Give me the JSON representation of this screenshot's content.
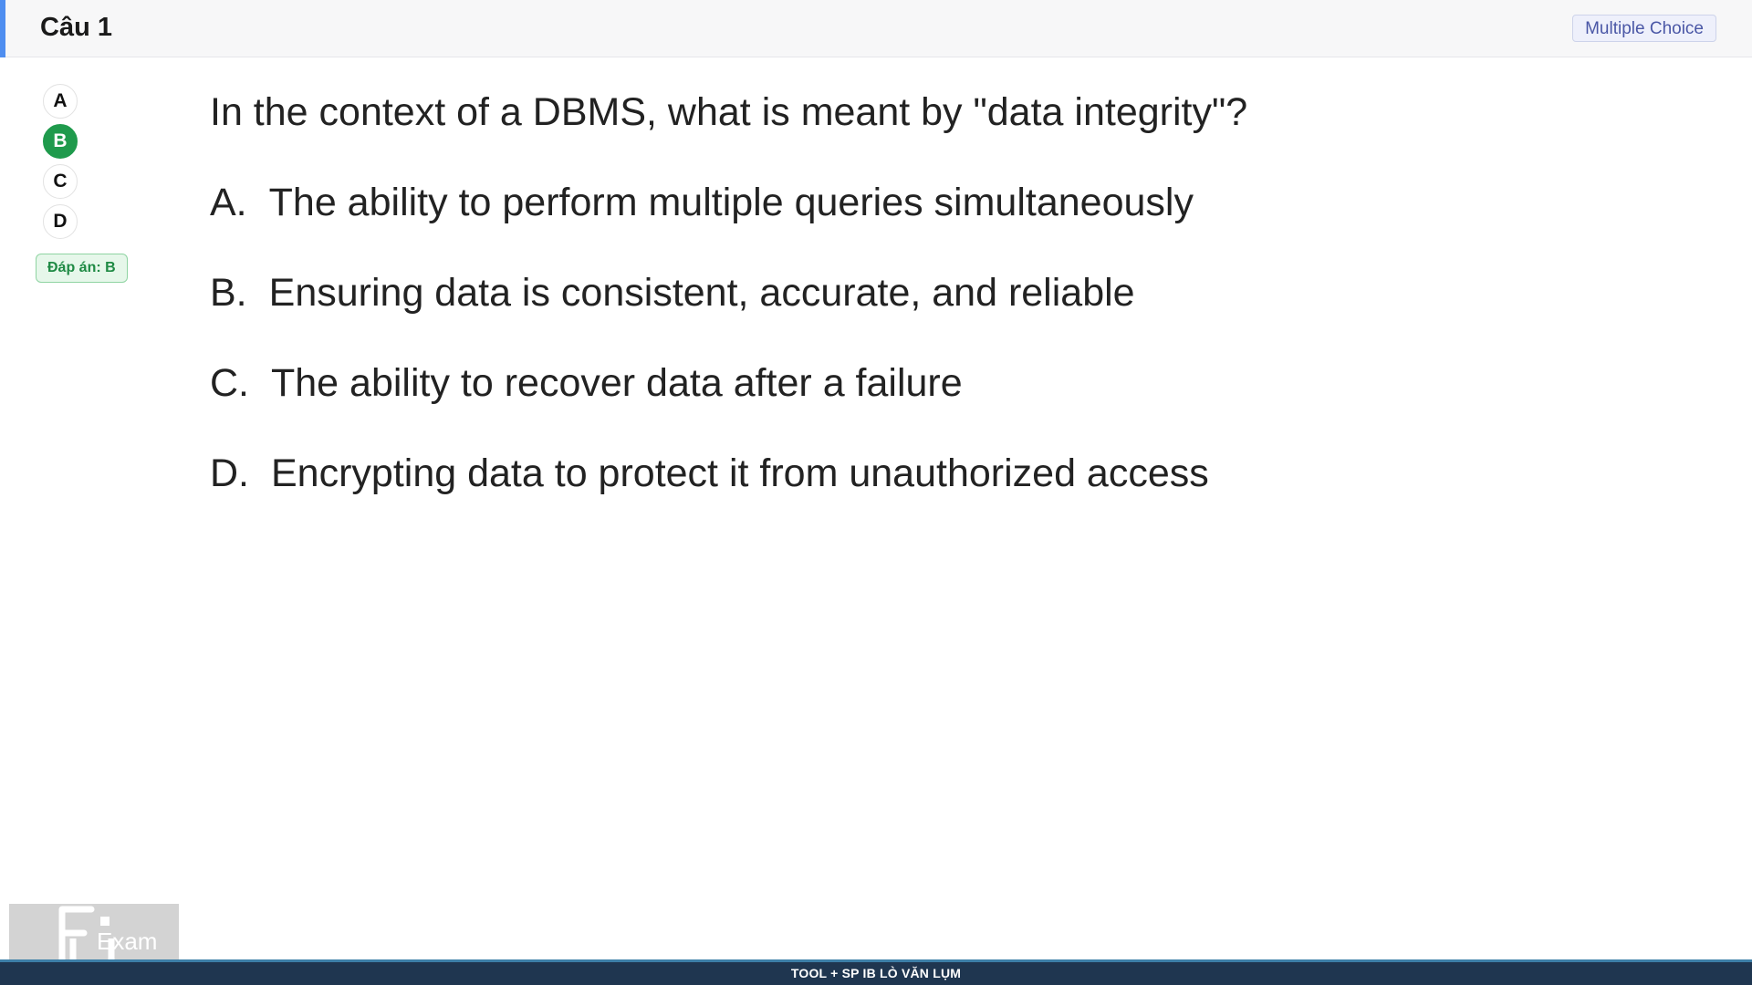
{
  "header": {
    "title": "Câu 1",
    "type_badge": "Multiple Choice",
    "accent_color": "#4f8ef0"
  },
  "choices": {
    "items": [
      "A",
      "B",
      "C",
      "D"
    ],
    "selected": "B",
    "selected_color": "#1f9a4c"
  },
  "answer_badge": "Đáp án: B",
  "question": {
    "text": "In the context of a DBMS, what is meant by \"data integrity\"?",
    "options": [
      {
        "letter": "A.",
        "text": "The ability to perform multiple queries simultaneously"
      },
      {
        "letter": "B.",
        "text": "Ensuring data is consistent, accurate, and reliable"
      },
      {
        "letter": "C.",
        "text": "The ability to recover data after a failure"
      },
      {
        "letter": "D.",
        "text": "Encrypting data to protect it from unauthorized access"
      }
    ]
  },
  "logo": {
    "text": "Exam",
    "icon": "fu-exam-logo"
  },
  "footer": {
    "text": "TOOL + SP IB LÒ VĂN LỤM",
    "color": "#1f3650"
  }
}
